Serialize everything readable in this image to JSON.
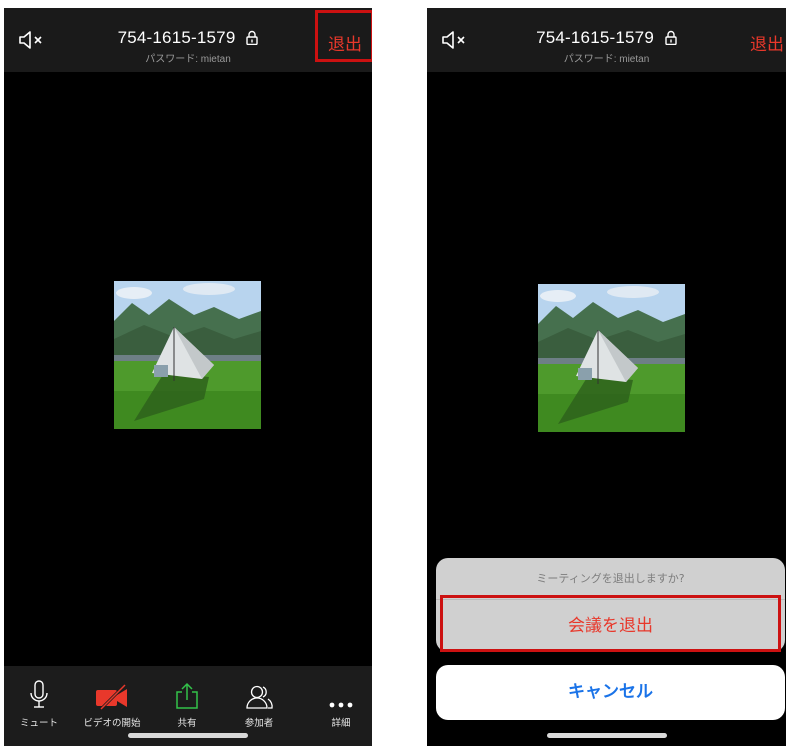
{
  "left_screen": {
    "meeting_id": "754-1615-1579",
    "password": "パスワード: mietan",
    "exit_label": "退出",
    "toolbar": [
      {
        "label": "ミュート",
        "icon": "microphone-icon"
      },
      {
        "label": "ビデオの開始",
        "icon": "video-off-icon"
      },
      {
        "label": "共有",
        "icon": "share-icon"
      },
      {
        "label": "参加者",
        "icon": "participants-icon"
      },
      {
        "label": "詳細",
        "icon": "more-icon"
      }
    ]
  },
  "right_screen": {
    "meeting_id": "754-1615-1579",
    "password": "パスワード: mietan",
    "exit_label": "退出",
    "dialog": {
      "title": "ミーティングを退出しますか?",
      "confirm_label": "会議を退出",
      "cancel_label": "キャンセル"
    }
  },
  "colors": {
    "exit_red": "#e8382b",
    "highlight_red": "#cc1111",
    "share_green": "#33c24a",
    "cancel_blue": "#1a73e8",
    "toolbar_bg": "#1c1c1c"
  }
}
